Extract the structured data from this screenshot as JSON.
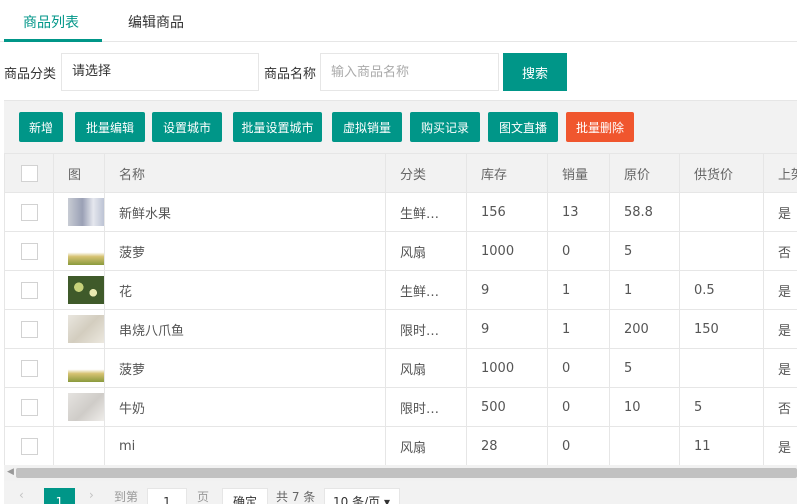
{
  "tabs": [
    {
      "label": "商品列表",
      "active": true
    },
    {
      "label": "编辑商品",
      "active": false
    }
  ],
  "filter": {
    "category_label": "商品分类",
    "category_value": "请选择",
    "name_label": "商品名称",
    "name_placeholder": "输入商品名称",
    "search_label": "搜索"
  },
  "toolbar": {
    "add": "新增",
    "batch_edit": "批量编辑",
    "set_city": "设置城市",
    "batch_set_city": "批量设置城市",
    "virtual_sales": "虚拟销量",
    "purchase_records": "购买记录",
    "live_text": "图文直播",
    "batch_delete": "批量删除"
  },
  "table": {
    "headers": [
      "图",
      "名称",
      "分类",
      "库存",
      "销量",
      "原价",
      "供货价",
      "上架"
    ],
    "rows": [
      {
        "image": "t1",
        "name": "新鲜水果",
        "category": "生鲜…",
        "stock": "156",
        "sales": "13",
        "price": "58.8",
        "supply": "",
        "listed": "是"
      },
      {
        "image": "t2",
        "name": "菠萝",
        "category": "风扇",
        "stock": "1000",
        "sales": "0",
        "price": "5",
        "supply": "",
        "listed": "否"
      },
      {
        "image": "t3",
        "name": "花",
        "category": "生鲜…",
        "stock": "9",
        "sales": "1",
        "price": "1",
        "supply": "0.5",
        "listed": "是"
      },
      {
        "image": "t4",
        "name": "串烧八爪鱼",
        "category": "限时…",
        "stock": "9",
        "sales": "1",
        "price": "200",
        "supply": "150",
        "listed": "是"
      },
      {
        "image": "t2",
        "name": "菠萝",
        "category": "风扇",
        "stock": "1000",
        "sales": "0",
        "price": "5",
        "supply": "",
        "listed": "是"
      },
      {
        "image": "t5",
        "name": "牛奶",
        "category": "限时…",
        "stock": "500",
        "sales": "0",
        "price": "10",
        "supply": "5",
        "listed": "否"
      },
      {
        "image": "",
        "name": "mi",
        "category": "风扇",
        "stock": "28",
        "sales": "0",
        "price": "",
        "supply": "11",
        "listed": "是"
      }
    ]
  },
  "pager": {
    "prev": "‹",
    "current": "1",
    "next": "›",
    "goto_label": "到第",
    "goto_value": "1",
    "page_label": "页",
    "confirm": "确定",
    "total": "共 7 条",
    "page_size": "10 条/页"
  },
  "colors": {
    "primary": "#009688",
    "danger": "#f0562e"
  }
}
